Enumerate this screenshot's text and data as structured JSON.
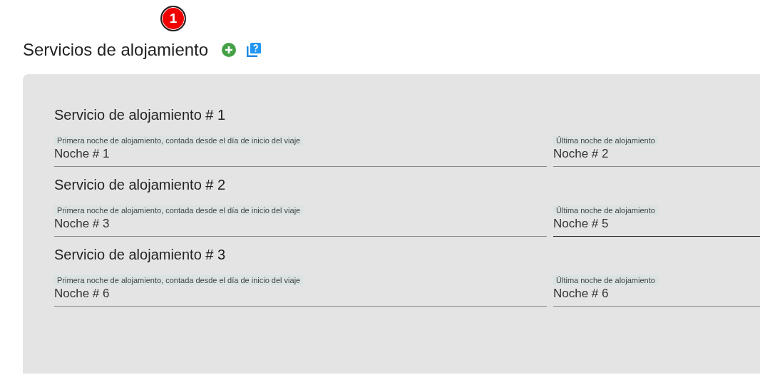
{
  "step_badge": "1",
  "title": "Servicios de alojamiento",
  "services": [
    {
      "heading": "Servicio de alojamiento # 1",
      "fields": [
        {
          "label": "Primera noche de alojamiento, contada desde el día de inicio del viaje",
          "value": "Noche # 1",
          "focused": false
        },
        {
          "label": "Última noche de alojamiento",
          "value": "Noche # 2",
          "focused": false
        }
      ]
    },
    {
      "heading": "Servicio de alojamiento # 2",
      "fields": [
        {
          "label": "Primera noche de alojamiento, contada desde el día de inicio del viaje",
          "value": "Noche # 3",
          "focused": false
        },
        {
          "label": "Última noche de alojamiento",
          "value": "Noche # 5",
          "focused": true
        }
      ]
    },
    {
      "heading": "Servicio de alojamiento # 3",
      "fields": [
        {
          "label": "Primera noche de alojamiento, contada desde el día de inicio del viaje",
          "value": "Noche # 6",
          "focused": false
        },
        {
          "label": "Última noche de alojamiento",
          "value": "Noche # 6",
          "focused": false
        }
      ]
    }
  ]
}
